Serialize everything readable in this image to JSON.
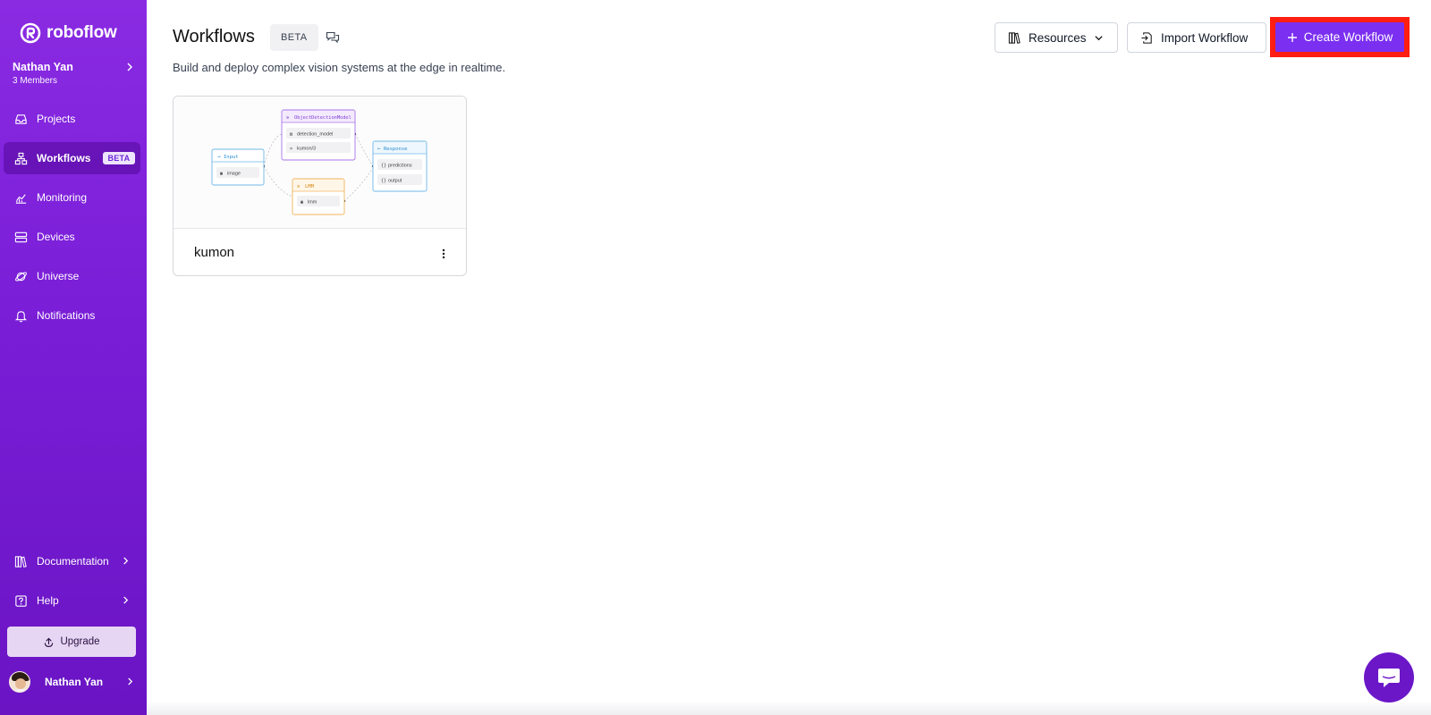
{
  "brand": {
    "name": "roboflow"
  },
  "workspace": {
    "name": "Nathan Yan",
    "members": "3 Members"
  },
  "sidebar": {
    "items": [
      {
        "label": "Projects",
        "icon": "inbox-icon"
      },
      {
        "label": "Workflows",
        "icon": "workflow-icon",
        "badge": "BETA",
        "active": true
      },
      {
        "label": "Monitoring",
        "icon": "chart-icon"
      },
      {
        "label": "Devices",
        "icon": "server-icon"
      },
      {
        "label": "Universe",
        "icon": "planet-icon"
      },
      {
        "label": "Notifications",
        "icon": "bell-icon"
      }
    ],
    "bottom_items": [
      {
        "label": "Documentation",
        "icon": "books-icon"
      },
      {
        "label": "Help",
        "icon": "help-icon"
      }
    ],
    "upgrade_label": "Upgrade",
    "user_name": "Nathan Yan"
  },
  "header": {
    "title": "Workflows",
    "badge": "BETA",
    "subtitle": "Build and deploy complex vision systems at the edge in realtime.",
    "resources_label": "Resources",
    "import_label": "Import Workflow",
    "create_label": "Create Workflow"
  },
  "workflows": [
    {
      "name": "kumon",
      "preview": {
        "input": {
          "title": "Input",
          "field": "image"
        },
        "model": {
          "title": "ObjectDetectionModel",
          "fields": [
            "detection_model",
            "kumon/3"
          ]
        },
        "lmm": {
          "title": "LMM",
          "field": "lmm"
        },
        "response": {
          "title": "Response",
          "fields": [
            "predictions",
            "output"
          ]
        }
      }
    }
  ],
  "colors": {
    "sidebar_top": "#8a2be2",
    "sidebar_bottom": "#6a14c4",
    "accent": "#7b2ff0",
    "highlight_border": "#ff1e12",
    "chat_bubble": "#6b17c8"
  }
}
